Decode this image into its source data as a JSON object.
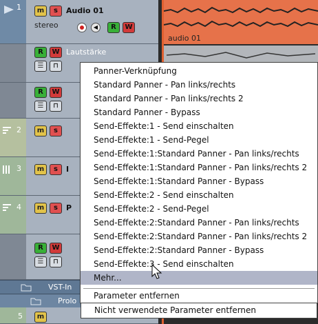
{
  "tracks": {
    "audio1": {
      "number": "1",
      "name": "Audio 01",
      "sub": "stereo",
      "m": "m",
      "s": "s",
      "r": "R",
      "w": "W"
    },
    "auto1": {
      "label": "Lautstärke",
      "r": "R",
      "w": "W"
    },
    "auto2": {
      "r": "R",
      "w": "W"
    },
    "t2": {
      "number": "2",
      "m": "m",
      "s": "s"
    },
    "t3": {
      "number": "3",
      "m": "m",
      "s": "s",
      "initial": "I"
    },
    "t4": {
      "number": "4",
      "m": "m",
      "s": "s",
      "initial": "P"
    },
    "auto3": {
      "r": "R",
      "w": "W"
    },
    "t5": {
      "number": "5",
      "m": "m"
    }
  },
  "folders": {
    "vst": "VST-In",
    "prolog": "Prolo"
  },
  "events": {
    "clip_name": "audio 01"
  },
  "menu": {
    "items": [
      "Panner-Verknüpfung",
      "Standard Panner - Pan links/rechts",
      "Standard Panner - Pan links/rechts 2",
      "Standard Panner - Bypass",
      "Send-Effekte:1 - Send einschalten",
      "Send-Effekte:1 - Send-Pegel",
      "Send-Effekte:1:Standard Panner - Pan links/rechts",
      "Send-Effekte:1:Standard Panner - Pan links/rechts 2",
      "Send-Effekte:1:Standard Panner - Bypass",
      "Send-Effekte:2 - Send einschalten",
      "Send-Effekte:2 - Send-Pegel",
      "Send-Effekte:2:Standard Panner - Pan links/rechts",
      "Send-Effekte:2:Standard Panner - Pan links/rechts 2",
      "Send-Effekte:2:Standard Panner - Bypass",
      "Send-Effekte:3 - Send einschalten",
      "Mehr..."
    ],
    "highlighted": "Mehr...",
    "footer": [
      "Parameter entfernen",
      "Nicht verwendete Parameter entfernen"
    ]
  },
  "colors": {
    "clip": "#e6724a",
    "menu_highlight": "#b0b5c8",
    "folder": "#5f7894"
  }
}
